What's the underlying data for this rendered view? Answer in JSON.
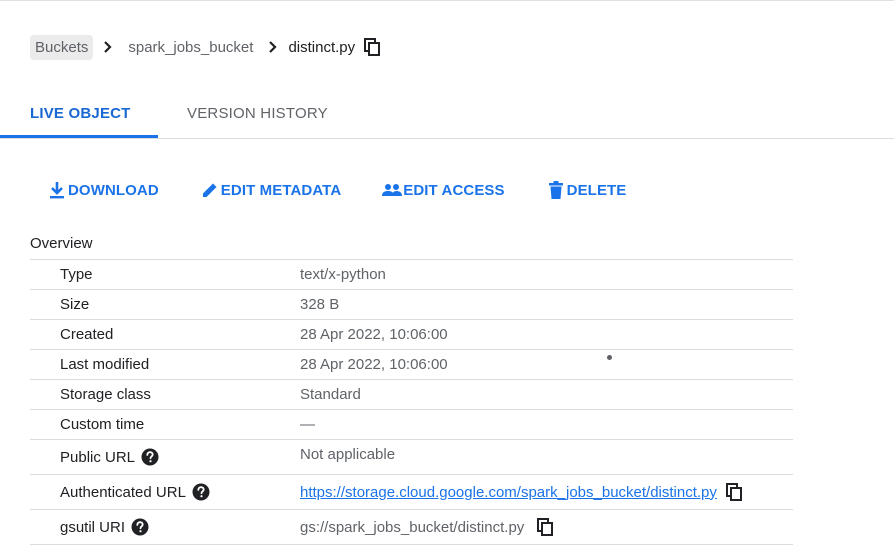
{
  "breadcrumb": {
    "root": "Buckets",
    "bucket": "spark_jobs_bucket",
    "object": "distinct.py"
  },
  "tabs": [
    {
      "label": "LIVE OBJECT",
      "active": true
    },
    {
      "label": "VERSION HISTORY",
      "active": false
    }
  ],
  "actions": {
    "download": "DOWNLOAD",
    "edit_metadata": "EDIT METADATA",
    "edit_access": "EDIT ACCESS",
    "delete": "DELETE"
  },
  "overview": {
    "title": "Overview",
    "rows": [
      {
        "label": "Type",
        "value": "text/x-python"
      },
      {
        "label": "Size",
        "value": "328 B"
      },
      {
        "label": "Created",
        "value": "28 Apr 2022, 10:06:00"
      },
      {
        "label": "Last modified",
        "value": "28 Apr 2022, 10:06:00"
      },
      {
        "label": "Storage class",
        "value": "Standard"
      },
      {
        "label": "Custom time",
        "value": "—"
      },
      {
        "label": "Public URL",
        "value": "Not applicable"
      },
      {
        "label": "Authenticated URL",
        "value": "https://storage.cloud.google.com/spark_jobs_bucket/distinct.py"
      },
      {
        "label": "gsutil URI",
        "value": "gs://spark_jobs_bucket/distinct.py"
      }
    ]
  },
  "colors": {
    "accent": "#1a73e8",
    "text": "#202124",
    "muted": "#5f6368",
    "divider": "#dadce0"
  },
  "icons": {
    "copy": "copy-icon",
    "chevron": "chevron-right-icon",
    "download": "download-icon",
    "edit": "pencil-icon",
    "access": "people-icon",
    "delete": "trash-icon",
    "help": "help-icon"
  }
}
